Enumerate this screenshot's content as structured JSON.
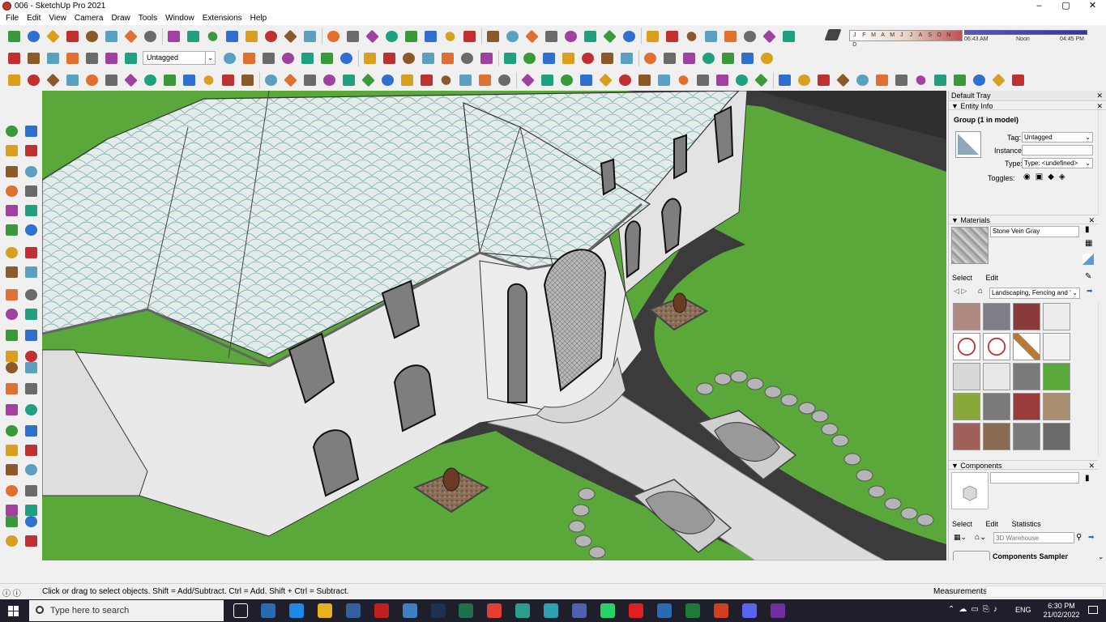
{
  "window": {
    "title": "006 - SketchUp Pro 2021",
    "minimize": "–",
    "maximize": "▢",
    "close": "✕"
  },
  "menu": [
    "File",
    "Edit",
    "View",
    "Camera",
    "Draw",
    "Tools",
    "Window",
    "Extensions",
    "Help"
  ],
  "toolbar": {
    "tag_dropdown": "Untagged",
    "shadow_months": [
      "J",
      "F",
      "M",
      "A",
      "M",
      "J",
      "J",
      "A",
      "S",
      "O",
      "N",
      "D"
    ],
    "time_start": "06:43 AM",
    "time_noon": "Noon",
    "time_end": "04:45 PM"
  },
  "tray": {
    "title": "Default Tray",
    "entity_info": {
      "header": "Entity Info",
      "selection": "Group (1 in model)",
      "tag_label": "Tag:",
      "tag_value": "Untagged",
      "instance_label": "Instance:",
      "instance_value": "",
      "type_label": "Type:",
      "type_value": "Type: <undefined>",
      "toggles_label": "Toggles:"
    },
    "materials": {
      "header": "Materials",
      "name": "Stone Vein Gray",
      "tab_select": "Select",
      "tab_edit": "Edit",
      "library": "Landscaping, Fencing and '"
    },
    "components": {
      "header": "Components",
      "tab_select": "Select",
      "tab_edit": "Edit",
      "tab_statistics": "Statistics",
      "search_placeholder": "3D Warehouse",
      "sampler": "Components Sampler"
    }
  },
  "status": {
    "message": "Click or drag to select objects. Shift = Add/Subtract. Ctrl = Add. Shift + Ctrl = Subtract.",
    "measurements_label": "Measurements"
  },
  "taskbar": {
    "search_placeholder": "Type here to search",
    "language": "ENG",
    "time": "6:30 PM",
    "date": "21/02/2022"
  },
  "colors": {
    "grass": "#5aa83a",
    "road": "#3b3b3b",
    "wall": "#e9e9e9",
    "roof": "#d9e6e3",
    "path": "#dcdcdc"
  }
}
